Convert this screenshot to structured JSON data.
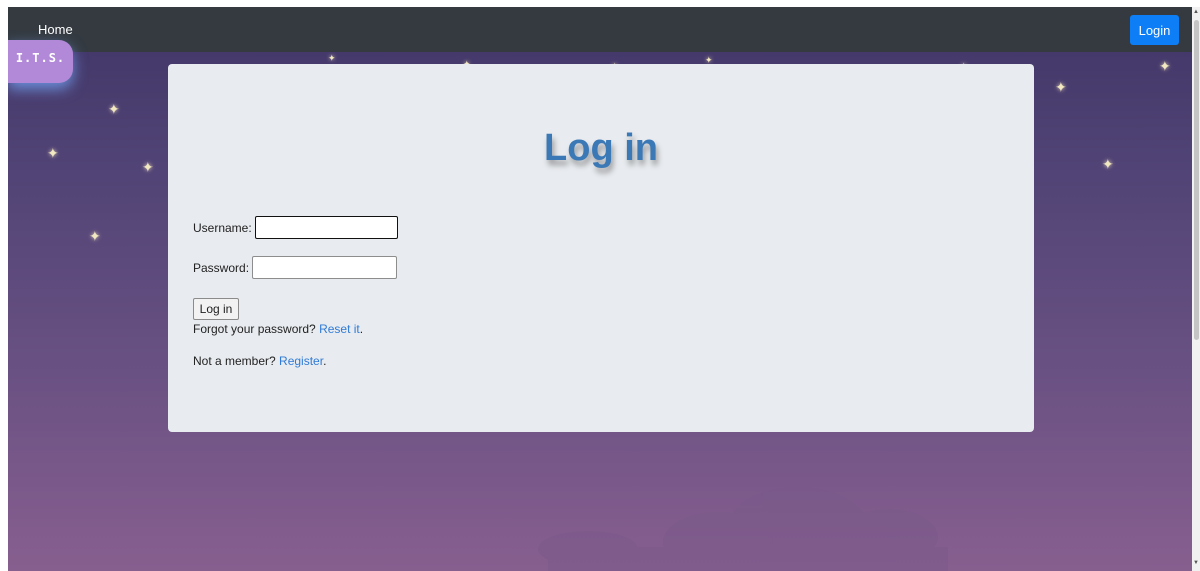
{
  "navbar": {
    "home_label": "Home",
    "login_label": "Login"
  },
  "logo": {
    "text": "I.T.S."
  },
  "login_form": {
    "title": "Log in",
    "username_label": "Username:",
    "username_value": "",
    "password_label": "Password:",
    "password_value": "",
    "submit_label": "Log in",
    "forgot_text": "Forgot your password?",
    "reset_link": "Reset it",
    "forgot_suffix": ".",
    "not_member_text": "Not a member?",
    "register_link": "Register",
    "register_suffix": "."
  },
  "colors": {
    "navbar_bg": "#343a40",
    "login_button": "#0d7ef5",
    "title": "#3b79b6",
    "link": "#2f7bd6",
    "logo_bg": "#b289d8",
    "card_bg": "#e8ebef"
  },
  "icons": {
    "decor": "star-icon",
    "cloud": "cloud-icon"
  }
}
